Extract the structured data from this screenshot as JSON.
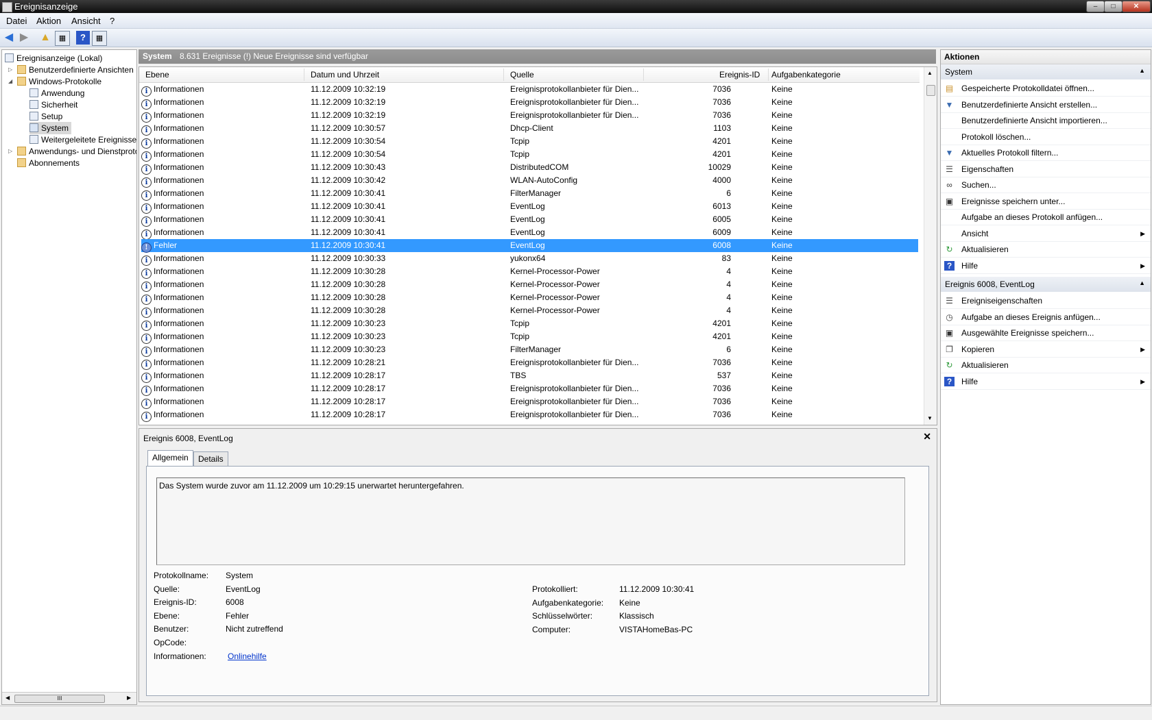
{
  "window": {
    "title": "Ereignisanzeige",
    "min": "‒",
    "max": "□",
    "close": "✕"
  },
  "menu": [
    "Datei",
    "Aktion",
    "Ansicht",
    "?"
  ],
  "tree": {
    "root": "Ereignisanzeige (Lokal)",
    "custom_views": "Benutzerdefinierte Ansichten",
    "windows_logs": "Windows-Protokolle",
    "logs": [
      "Anwendung",
      "Sicherheit",
      "Setup",
      "System",
      "Weitergeleitete Ereignisse"
    ],
    "apps_services": "Anwendungs- und Dienstprotokolle",
    "subscriptions": "Abonnements",
    "hscroll_grip": "III"
  },
  "center": {
    "log_name": "System",
    "summary": "8.631 Ereignisse (!) Neue Ereignisse sind verfügbar"
  },
  "grid": {
    "columns": [
      "Ebene",
      "Datum und Uhrzeit",
      "Quelle",
      "Ereignis-ID",
      "Aufgabenkategorie"
    ],
    "rows": [
      [
        "Informationen",
        "11.12.2009 10:32:19",
        "Ereignisprotokollanbieter für Dien...",
        "7036",
        "Keine"
      ],
      [
        "Informationen",
        "11.12.2009 10:32:19",
        "Ereignisprotokollanbieter für Dien...",
        "7036",
        "Keine"
      ],
      [
        "Informationen",
        "11.12.2009 10:32:19",
        "Ereignisprotokollanbieter für Dien...",
        "7036",
        "Keine"
      ],
      [
        "Informationen",
        "11.12.2009 10:30:57",
        "Dhcp-Client",
        "1103",
        "Keine"
      ],
      [
        "Informationen",
        "11.12.2009 10:30:54",
        "Tcpip",
        "4201",
        "Keine"
      ],
      [
        "Informationen",
        "11.12.2009 10:30:54",
        "Tcpip",
        "4201",
        "Keine"
      ],
      [
        "Informationen",
        "11.12.2009 10:30:43",
        "DistributedCOM",
        "10029",
        "Keine"
      ],
      [
        "Informationen",
        "11.12.2009 10:30:42",
        "WLAN-AutoConfig",
        "4000",
        "Keine"
      ],
      [
        "Informationen",
        "11.12.2009 10:30:41",
        "FilterManager",
        "6",
        "Keine"
      ],
      [
        "Informationen",
        "11.12.2009 10:30:41",
        "EventLog",
        "6013",
        "Keine"
      ],
      [
        "Informationen",
        "11.12.2009 10:30:41",
        "EventLog",
        "6005",
        "Keine"
      ],
      [
        "Informationen",
        "11.12.2009 10:30:41",
        "EventLog",
        "6009",
        "Keine"
      ],
      [
        "Fehler",
        "11.12.2009 10:30:41",
        "EventLog",
        "6008",
        "Keine"
      ],
      [
        "Informationen",
        "11.12.2009 10:30:33",
        "yukonx64",
        "83",
        "Keine"
      ],
      [
        "Informationen",
        "11.12.2009 10:30:28",
        "Kernel-Processor-Power",
        "4",
        "Keine"
      ],
      [
        "Informationen",
        "11.12.2009 10:30:28",
        "Kernel-Processor-Power",
        "4",
        "Keine"
      ],
      [
        "Informationen",
        "11.12.2009 10:30:28",
        "Kernel-Processor-Power",
        "4",
        "Keine"
      ],
      [
        "Informationen",
        "11.12.2009 10:30:28",
        "Kernel-Processor-Power",
        "4",
        "Keine"
      ],
      [
        "Informationen",
        "11.12.2009 10:30:23",
        "Tcpip",
        "4201",
        "Keine"
      ],
      [
        "Informationen",
        "11.12.2009 10:30:23",
        "Tcpip",
        "4201",
        "Keine"
      ],
      [
        "Informationen",
        "11.12.2009 10:30:23",
        "FilterManager",
        "6",
        "Keine"
      ],
      [
        "Informationen",
        "11.12.2009 10:28:21",
        "Ereignisprotokollanbieter für Dien...",
        "7036",
        "Keine"
      ],
      [
        "Informationen",
        "11.12.2009 10:28:17",
        "TBS",
        "537",
        "Keine"
      ],
      [
        "Informationen",
        "11.12.2009 10:28:17",
        "Ereignisprotokollanbieter für Dien...",
        "7036",
        "Keine"
      ],
      [
        "Informationen",
        "11.12.2009 10:28:17",
        "Ereignisprotokollanbieter für Dien...",
        "7036",
        "Keine"
      ],
      [
        "Informationen",
        "11.12.2009 10:28:17",
        "Ereignisprotokollanbieter für Dien...",
        "7036",
        "Keine"
      ]
    ],
    "selected_index": 12
  },
  "detail": {
    "title": "Ereignis 6008, EventLog",
    "close": "✕",
    "tabs": [
      "Allgemein",
      "Details"
    ],
    "message": "Das System wurde zuvor am 11.12.2009 um 10:29:15 unerwartet heruntergefahren.",
    "fields_left": [
      {
        "label": "Protokollname:",
        "value": "System"
      },
      {
        "label": "Quelle:",
        "value": "EventLog"
      },
      {
        "label": "Ereignis-ID:",
        "value": "6008"
      },
      {
        "label": "Ebene:",
        "value": "Fehler"
      },
      {
        "label": "Benutzer:",
        "value": "Nicht zutreffend"
      },
      {
        "label": "OpCode:",
        "value": ""
      },
      {
        "label": "Informationen:",
        "value": "Onlinehilfe"
      }
    ],
    "fields_right": [
      {
        "label": "Protokolliert:",
        "value": "11.12.2009 10:30:41"
      },
      {
        "label": "Aufgabenkategorie:",
        "value": "Keine"
      },
      {
        "label": "Schlüsselwörter:",
        "value": "Klassisch"
      },
      {
        "label": "Computer:",
        "value": "VISTAHomeBas-PC"
      }
    ]
  },
  "actions": {
    "header": "Aktionen",
    "section1": "System",
    "items1": [
      {
        "label": "Gespeicherte Protokolldatei öffnen...",
        "icon": "open-folder-icon"
      },
      {
        "label": "Benutzerdefinierte Ansicht erstellen...",
        "icon": "filter-icon"
      },
      {
        "label": "Benutzerdefinierte Ansicht importieren...",
        "icon": ""
      },
      {
        "label": "Protokoll löschen...",
        "icon": ""
      },
      {
        "label": "Aktuelles Protokoll filtern...",
        "icon": "filter-icon"
      },
      {
        "label": "Eigenschaften",
        "icon": "properties-icon"
      },
      {
        "label": "Suchen...",
        "icon": "binoculars-icon"
      },
      {
        "label": "Ereignisse speichern unter...",
        "icon": "save-icon"
      },
      {
        "label": "Aufgabe an dieses Protokoll anfügen...",
        "icon": ""
      },
      {
        "label": "Ansicht",
        "icon": "",
        "submenu": true
      },
      {
        "label": "Aktualisieren",
        "icon": "refresh-icon"
      },
      {
        "label": "Hilfe",
        "icon": "help-icon",
        "submenu": true
      }
    ],
    "section2": "Ereignis 6008, EventLog",
    "items2": [
      {
        "label": "Ereigniseigenschaften",
        "icon": "properties-icon"
      },
      {
        "label": "Aufgabe an dieses Ereignis anfügen...",
        "icon": "task-icon"
      },
      {
        "label": "Ausgewählte Ereignisse speichern...",
        "icon": "save-icon"
      },
      {
        "label": "Kopieren",
        "icon": "copy-icon",
        "submenu": true
      },
      {
        "label": "Aktualisieren",
        "icon": "refresh-icon"
      },
      {
        "label": "Hilfe",
        "icon": "help-icon",
        "submenu": true
      }
    ]
  }
}
